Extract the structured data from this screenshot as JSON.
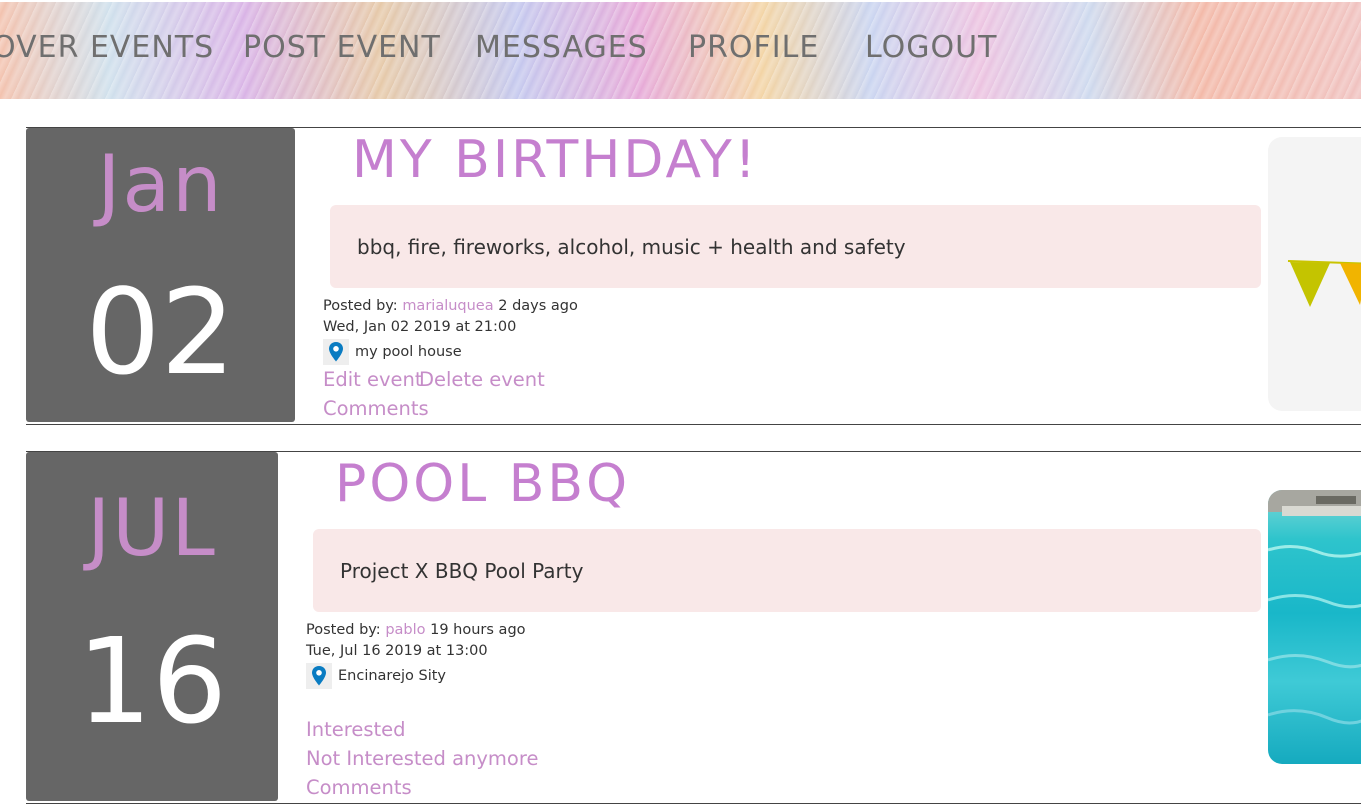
{
  "nav": {
    "items": [
      "over Events",
      "Post Event",
      "Messages",
      "Profile",
      "Logout"
    ]
  },
  "events": [
    {
      "month": "Jan",
      "day": "02",
      "title": "MY BIRTHDAY!",
      "description": "bbq, fire, fireworks, alcohol, music + health and safety",
      "posted_by_label": "Posted by:",
      "user": "marialuquea",
      "posted_ago": "2 days ago",
      "datetime": "Wed, Jan 02 2019 at 21:00",
      "location": "my pool house",
      "edit_label": "Edit event",
      "delete_label": "Delete event",
      "comments_label": "Comments",
      "image": "bunting-image"
    },
    {
      "month": "JUL",
      "day": "16",
      "title": "POOL BBQ",
      "description": "Project X BBQ Pool Party",
      "posted_by_label": "Posted by:",
      "user": "pablo",
      "posted_ago": "19 hours ago",
      "datetime": "Tue, Jul 16 2019 at 13:00",
      "location": "Encinarejo Sity",
      "interested_label": "Interested",
      "not_interested_label": "Not Interested anymore",
      "comments_label": "Comments",
      "image": "pool-image"
    }
  ],
  "colors": {
    "accent": "#c68dc8",
    "date_box": "#666666",
    "desc_bg": "#f9e8e8",
    "pin": "#0a7cc2"
  }
}
